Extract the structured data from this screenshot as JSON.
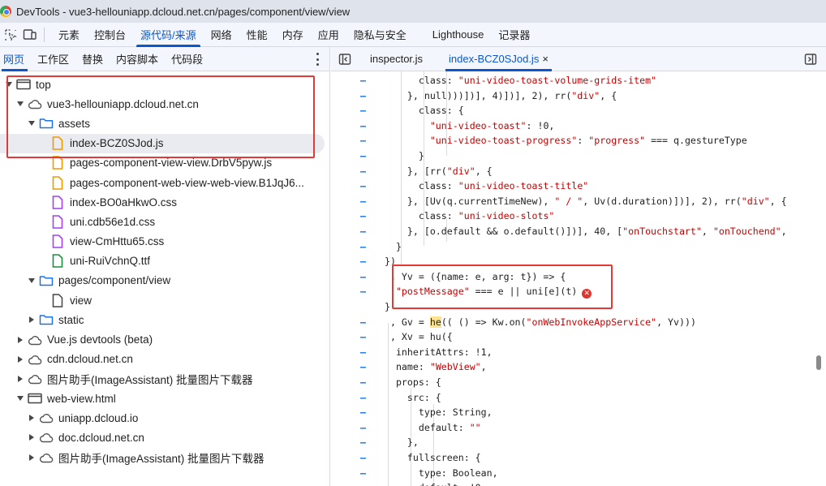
{
  "window": {
    "title": "DevTools - vue3-hellouniapp.dcloud.net.cn/pages/component/view/view"
  },
  "main_tabs": [
    {
      "label": "元素"
    },
    {
      "label": "控制台"
    },
    {
      "label": "源代码/来源",
      "active": true
    },
    {
      "label": "网络"
    },
    {
      "label": "性能"
    },
    {
      "label": "内存"
    },
    {
      "label": "应用"
    },
    {
      "label": "隐私与安全"
    },
    {
      "label": "Lighthouse"
    },
    {
      "label": "记录器"
    }
  ],
  "left_tabs": [
    {
      "label": "网页",
      "active": true
    },
    {
      "label": "工作区"
    },
    {
      "label": "替换"
    },
    {
      "label": "内容脚本"
    },
    {
      "label": "代码段"
    }
  ],
  "tree": [
    {
      "label": "top",
      "icon": "frame-icon",
      "toggle": "open",
      "level": 0
    },
    {
      "label": "vue3-hellouniapp.dcloud.net.cn",
      "icon": "cloud-icon",
      "toggle": "open",
      "level": 1
    },
    {
      "label": "assets",
      "icon": "folder-icon",
      "toggle": "open",
      "level": 2
    },
    {
      "label": "index-BCZ0SJod.js",
      "icon": "js-file-icon",
      "toggle": "none",
      "level": 3,
      "selected": true
    },
    {
      "label": "pages-component-view-view.DrbV5pyw.js",
      "icon": "js-file-icon",
      "toggle": "none",
      "level": 3
    },
    {
      "label": "pages-component-web-view-web-view.B1JqJ6...",
      "icon": "js-file-icon",
      "toggle": "none",
      "level": 3
    },
    {
      "label": "index-BO0aHkwO.css",
      "icon": "css-file-icon",
      "toggle": "none",
      "level": 3
    },
    {
      "label": "uni.cdb56e1d.css",
      "icon": "css-file-icon",
      "toggle": "none",
      "level": 3
    },
    {
      "label": "view-CmHttu65.css",
      "icon": "css-file-icon",
      "toggle": "none",
      "level": 3
    },
    {
      "label": "uni-RuiVchnQ.ttf",
      "icon": "font-file-icon",
      "toggle": "none",
      "level": 3
    },
    {
      "label": "pages/component/view",
      "icon": "folder-icon",
      "toggle": "open",
      "level": 2
    },
    {
      "label": "view",
      "icon": "doc-file-icon",
      "toggle": "none",
      "level": 3
    },
    {
      "label": "static",
      "icon": "folder-icon",
      "toggle": "closed",
      "level": 2
    },
    {
      "label": "Vue.js devtools (beta)",
      "icon": "cloud-icon",
      "toggle": "closed",
      "level": 1
    },
    {
      "label": "cdn.dcloud.net.cn",
      "icon": "cloud-icon",
      "toggle": "closed",
      "level": 1
    },
    {
      "label": "图片助手(ImageAssistant) 批量图片下载器",
      "icon": "cloud-icon",
      "toggle": "closed",
      "level": 1
    },
    {
      "label": "web-view.html",
      "icon": "frame-icon",
      "toggle": "open",
      "level": 1
    },
    {
      "label": "uniapp.dcloud.io",
      "icon": "cloud-icon",
      "toggle": "closed",
      "level": 2
    },
    {
      "label": "doc.dcloud.net.cn",
      "icon": "cloud-icon",
      "toggle": "closed",
      "level": 2
    },
    {
      "label": "图片助手(ImageAssistant) 批量图片下载器",
      "icon": "cloud-icon",
      "toggle": "closed",
      "level": 2
    }
  ],
  "editor_tabs": [
    {
      "label": "inspector.js",
      "active": false
    },
    {
      "label": "index-BCZ0SJod.js",
      "active": true,
      "close": "×"
    }
  ],
  "gutter_marker": "–",
  "code_lines": [
    {
      "marker": true,
      "indent": 6,
      "segs": [
        [
          "p",
          "class: "
        ],
        [
          "s",
          "\"uni-video-toast-volume-grids-item\""
        ]
      ]
    },
    {
      "marker": true,
      "indent": 4,
      "segs": [
        [
          "p",
          "}, null)))])], 4)])], 2), rr("
        ],
        [
          "s",
          "\"div\""
        ],
        [
          "p",
          ", {"
        ]
      ]
    },
    {
      "marker": true,
      "indent": 6,
      "segs": [
        [
          "p",
          "class: {"
        ]
      ]
    },
    {
      "marker": true,
      "indent": 8,
      "segs": [
        [
          "s",
          "\"uni-video-toast\""
        ],
        [
          "p",
          ": !0,"
        ]
      ]
    },
    {
      "marker": true,
      "indent": 8,
      "segs": [
        [
          "s",
          "\"uni-video-toast-progress\""
        ],
        [
          "p",
          ": "
        ],
        [
          "s",
          "\"progress\""
        ],
        [
          "p",
          " === q.gestureType"
        ]
      ]
    },
    {
      "marker": true,
      "indent": 6,
      "segs": [
        [
          "p",
          "}"
        ]
      ]
    },
    {
      "marker": true,
      "indent": 4,
      "segs": [
        [
          "p",
          "}, [rr("
        ],
        [
          "s",
          "\"div\""
        ],
        [
          "p",
          ", {"
        ]
      ]
    },
    {
      "marker": true,
      "indent": 6,
      "segs": [
        [
          "p",
          "class: "
        ],
        [
          "s",
          "\"uni-video-toast-title\""
        ]
      ]
    },
    {
      "marker": true,
      "indent": 4,
      "segs": [
        [
          "p",
          "}, [Uv(q.currentTimeNew), "
        ],
        [
          "s",
          "\" / \""
        ],
        [
          "p",
          ", Uv(d.duration)])], 2), rr("
        ],
        [
          "s",
          "\"div\""
        ],
        [
          "p",
          ", {"
        ]
      ]
    },
    {
      "marker": true,
      "indent": 6,
      "segs": [
        [
          "p",
          "class: "
        ],
        [
          "s",
          "\"uni-video-slots\""
        ]
      ]
    },
    {
      "marker": true,
      "indent": 4,
      "segs": [
        [
          "p",
          "}, [o.default && o.default()])], 40, ["
        ],
        [
          "s",
          "\"onTouchstart\""
        ],
        [
          "p",
          ", "
        ],
        [
          "s",
          "\"onTouc"
        ],
        [
          "s",
          "hend\""
        ],
        [
          "p",
          ","
        ]
      ]
    },
    {
      "marker": true,
      "indent": 2,
      "segs": [
        [
          "p",
          "}"
        ]
      ]
    },
    {
      "marker": true,
      "indent": 0,
      "segs": [
        [
          "p",
          "})"
        ]
      ]
    },
    {
      "marker": true,
      "indent": 1,
      "segs": [
        [
          "p",
          ", Yv = ({name: e, arg: t}) => {"
        ]
      ]
    },
    {
      "marker": true,
      "indent": 2,
      "segs": [
        [
          "s",
          "\"postMessage\""
        ],
        [
          "p",
          " === e || uni[e](t)"
        ],
        [
          "e",
          ""
        ]
      ]
    },
    {
      "marker": false,
      "indent": 0,
      "segs": [
        [
          "p",
          "}"
        ]
      ]
    },
    {
      "marker": true,
      "indent": 1,
      "segs": [
        [
          "p",
          ", Gv = "
        ],
        [
          "h",
          "he"
        ],
        [
          "p",
          "(( () => Kw.on("
        ],
        [
          "s",
          "\"onWebInvokeAppService\""
        ],
        [
          "p",
          ", Yv)))"
        ]
      ]
    },
    {
      "marker": true,
      "indent": 1,
      "segs": [
        [
          "p",
          ", Xv = hu({"
        ]
      ]
    },
    {
      "marker": true,
      "indent": 2,
      "segs": [
        [
          "p",
          "inheritAttrs: !1,"
        ]
      ]
    },
    {
      "marker": true,
      "indent": 2,
      "segs": [
        [
          "p",
          "name: "
        ],
        [
          "s",
          "\"WebView\""
        ],
        [
          "p",
          ","
        ]
      ]
    },
    {
      "marker": true,
      "indent": 2,
      "segs": [
        [
          "p",
          "props: {"
        ]
      ]
    },
    {
      "marker": true,
      "indent": 4,
      "segs": [
        [
          "p",
          "src: {"
        ]
      ]
    },
    {
      "marker": true,
      "indent": 6,
      "segs": [
        [
          "p",
          "type: String,"
        ]
      ]
    },
    {
      "marker": true,
      "indent": 6,
      "segs": [
        [
          "p",
          "default: "
        ],
        [
          "s",
          "\"\""
        ]
      ]
    },
    {
      "marker": true,
      "indent": 4,
      "segs": [
        [
          "p",
          "},"
        ]
      ]
    },
    {
      "marker": true,
      "indent": 4,
      "segs": [
        [
          "p",
          "fullscreen: {"
        ]
      ]
    },
    {
      "marker": true,
      "indent": 6,
      "segs": [
        [
          "p",
          "type: Boolean,"
        ]
      ]
    },
    {
      "marker": true,
      "indent": 6,
      "segs": [
        [
          "p",
          "default: !0"
        ]
      ]
    }
  ],
  "error_glyph": "✕",
  "colors": {
    "accent": "#0b57d0",
    "annotation": "#e53935",
    "string": "#c80000",
    "error": "#dc362e"
  }
}
